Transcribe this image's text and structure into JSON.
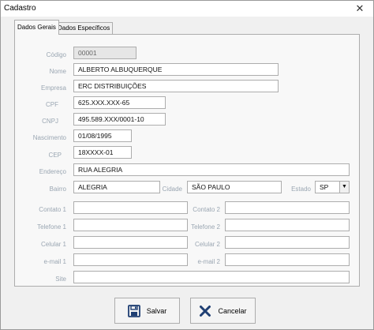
{
  "window": {
    "title": "Cadastro",
    "close_glyph": "✕"
  },
  "tabs": [
    {
      "label": "Dados Gerais",
      "active": true
    },
    {
      "label": "Dados Específicos",
      "active": false
    }
  ],
  "form": {
    "codigo": {
      "label": "Código",
      "value": "00001"
    },
    "nome": {
      "label": "Nome",
      "value": "ALBERTO ALBUQUERQUE"
    },
    "empresa": {
      "label": "Empresa",
      "value": "ERC DISTRIBUIÇÕES"
    },
    "cpf": {
      "label": "CPF",
      "value": "625.XXX.XXX-65"
    },
    "cnpj": {
      "label": "CNPJ",
      "value": "495.589.XXX/0001-10"
    },
    "nascimento": {
      "label": "Nascimento",
      "value": "01/08/1995"
    },
    "cep": {
      "label": "CEP",
      "value": "18XXXX-01"
    },
    "endereco": {
      "label": "Endereço",
      "value": "RUA ALEGRIA"
    },
    "bairro": {
      "label": "Bairro",
      "value": "ALEGRIA"
    },
    "cidade": {
      "label": "Cidade",
      "value": "SÃO PAULO"
    },
    "estado": {
      "label": "Estado",
      "value": "SP"
    },
    "contato1": {
      "label": "Contato 1",
      "value": ""
    },
    "contato2": {
      "label": "Contato 2",
      "value": ""
    },
    "telefone1": {
      "label": "Telefone 1",
      "value": ""
    },
    "telefone2": {
      "label": "Telefone 2",
      "value": ""
    },
    "celular1": {
      "label": "Celular 1",
      "value": ""
    },
    "celular2": {
      "label": "Celular 2",
      "value": ""
    },
    "email1": {
      "label": "e-mail 1",
      "value": ""
    },
    "email2": {
      "label": "e-mail 2",
      "value": ""
    },
    "site": {
      "label": "Site",
      "value": ""
    }
  },
  "buttons": {
    "salvar": {
      "label": "Salvar",
      "icon": "save-icon"
    },
    "cancelar": {
      "label": "Cancelar",
      "icon": "cancel-icon"
    }
  },
  "colors": {
    "label": "#9aa6b2",
    "save_icon": "#1f3f73",
    "cancel_icon": "#1f3f73"
  }
}
